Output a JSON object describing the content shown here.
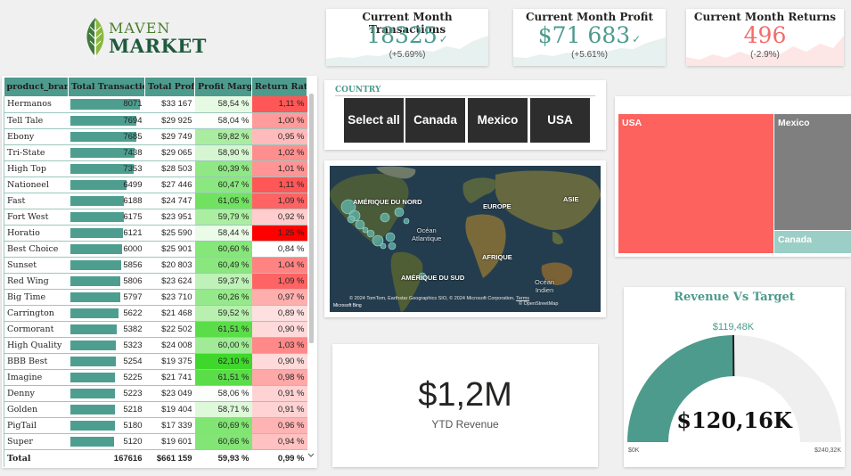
{
  "logo": {
    "line1": "MAVEN",
    "line2": "MARKET"
  },
  "kpis": [
    {
      "title": "Current Month Transactions",
      "value": "18325",
      "change": "(+5.69%)",
      "color": "#4d9b8d",
      "trend": "up"
    },
    {
      "title": "Current Month Profit",
      "value": "$71 683",
      "change": "(+5.61%)",
      "color": "#4d9b8d",
      "trend": "up"
    },
    {
      "title": "Current Month Returns",
      "value": "496",
      "change": "(-2.9%)",
      "color": "#f26b6b",
      "trend": "down"
    }
  ],
  "table": {
    "columns": [
      "product_brand",
      "Total Transactions",
      "Total Profit",
      "Profit Margin",
      "Return Rate"
    ],
    "rows": [
      {
        "brand": "Hermanos",
        "tx": "8071",
        "tx_value": 8071,
        "profit": "$33 167",
        "margin": "58,54 %",
        "margin_value": 58.54,
        "rr": "1,11 %",
        "rr_value": 1.11
      },
      {
        "brand": "Tell Tale",
        "tx": "7694",
        "tx_value": 7694,
        "profit": "$29 925",
        "margin": "58,04 %",
        "margin_value": 58.04,
        "rr": "1,00 %",
        "rr_value": 1.0
      },
      {
        "brand": "Ebony",
        "tx": "7685",
        "tx_value": 7685,
        "profit": "$29 749",
        "margin": "59,82 %",
        "margin_value": 59.82,
        "rr": "0,95 %",
        "rr_value": 0.95
      },
      {
        "brand": "Tri-State",
        "tx": "7438",
        "tx_value": 7438,
        "profit": "$29 065",
        "margin": "58,90 %",
        "margin_value": 58.9,
        "rr": "1,02 %",
        "rr_value": 1.02
      },
      {
        "brand": "High Top",
        "tx": "7353",
        "tx_value": 7353,
        "profit": "$28 503",
        "margin": "60,39 %",
        "margin_value": 60.39,
        "rr": "1,01 %",
        "rr_value": 1.01
      },
      {
        "brand": "Nationeel",
        "tx": "6499",
        "tx_value": 6499,
        "profit": "$27 446",
        "margin": "60,47 %",
        "margin_value": 60.47,
        "rr": "1,11 %",
        "rr_value": 1.11
      },
      {
        "brand": "Fast",
        "tx": "6188",
        "tx_value": 6188,
        "profit": "$24 747",
        "margin": "61,05 %",
        "margin_value": 61.05,
        "rr": "1,09 %",
        "rr_value": 1.09
      },
      {
        "brand": "Fort West",
        "tx": "6175",
        "tx_value": 6175,
        "profit": "$23 951",
        "margin": "59,79 %",
        "margin_value": 59.79,
        "rr": "0,92 %",
        "rr_value": 0.92
      },
      {
        "brand": "Horatio",
        "tx": "6121",
        "tx_value": 6121,
        "profit": "$25 590",
        "margin": "58,44 %",
        "margin_value": 58.44,
        "rr": "1,25 %",
        "rr_value": 1.25
      },
      {
        "brand": "Best Choice",
        "tx": "6000",
        "tx_value": 6000,
        "profit": "$25 901",
        "margin": "60,60 %",
        "margin_value": 60.6,
        "rr": "0,84 %",
        "rr_value": 0.84
      },
      {
        "brand": "Sunset",
        "tx": "5856",
        "tx_value": 5856,
        "profit": "$20 803",
        "margin": "60,49 %",
        "margin_value": 60.49,
        "rr": "1,04 %",
        "rr_value": 1.04
      },
      {
        "brand": "Red Wing",
        "tx": "5806",
        "tx_value": 5806,
        "profit": "$23 624",
        "margin": "59,37 %",
        "margin_value": 59.37,
        "rr": "1,09 %",
        "rr_value": 1.09
      },
      {
        "brand": "Big Time",
        "tx": "5797",
        "tx_value": 5797,
        "profit": "$23 710",
        "margin": "60,26 %",
        "margin_value": 60.26,
        "rr": "0,97 %",
        "rr_value": 0.97
      },
      {
        "brand": "Carrington",
        "tx": "5622",
        "tx_value": 5622,
        "profit": "$21 468",
        "margin": "59,52 %",
        "margin_value": 59.52,
        "rr": "0,89 %",
        "rr_value": 0.89
      },
      {
        "brand": "Cormorant",
        "tx": "5382",
        "tx_value": 5382,
        "profit": "$22 502",
        "margin": "61,51 %",
        "margin_value": 61.51,
        "rr": "0,90 %",
        "rr_value": 0.9
      },
      {
        "brand": "High Quality",
        "tx": "5323",
        "tx_value": 5323,
        "profit": "$24 008",
        "margin": "60,00 %",
        "margin_value": 60.0,
        "rr": "1,03 %",
        "rr_value": 1.03
      },
      {
        "brand": "BBB Best",
        "tx": "5254",
        "tx_value": 5254,
        "profit": "$19 375",
        "margin": "62,10 %",
        "margin_value": 62.1,
        "rr": "0,90 %",
        "rr_value": 0.9
      },
      {
        "brand": "Imagine",
        "tx": "5225",
        "tx_value": 5225,
        "profit": "$21 741",
        "margin": "61,51 %",
        "margin_value": 61.51,
        "rr": "0,98 %",
        "rr_value": 0.98
      },
      {
        "brand": "Denny",
        "tx": "5223",
        "tx_value": 5223,
        "profit": "$23 049",
        "margin": "58,06 %",
        "margin_value": 58.06,
        "rr": "0,91 %",
        "rr_value": 0.91
      },
      {
        "brand": "Golden",
        "tx": "5218",
        "tx_value": 5218,
        "profit": "$19 404",
        "margin": "58,71 %",
        "margin_value": 58.71,
        "rr": "0,91 %",
        "rr_value": 0.91
      },
      {
        "brand": "PigTail",
        "tx": "5180",
        "tx_value": 5180,
        "profit": "$17 339",
        "margin": "60,69 %",
        "margin_value": 60.69,
        "rr": "0,96 %",
        "rr_value": 0.96
      },
      {
        "brand": "Super",
        "tx": "5120",
        "tx_value": 5120,
        "profit": "$19 601",
        "margin": "60,66 %",
        "margin_value": 60.66,
        "rr": "0,94 %",
        "rr_value": 0.94
      }
    ],
    "total": {
      "label": "Total",
      "tx": "167616",
      "profit": "$661 159",
      "margin": "59,93 %",
      "rr": "0,99 %"
    }
  },
  "slicer": {
    "header": "COUNTRY",
    "options": [
      "Select all",
      "Canada",
      "Mexico",
      "USA"
    ]
  },
  "map": {
    "labels": {
      "na": "AMÉRIQUE DU NORD",
      "eu": "EUROPE",
      "as": "ASIE",
      "af": "AFRIQUE",
      "sa": "AMÉRIQUE DU SUD"
    },
    "oceans": {
      "atl1": "Océan",
      "atl2": "Atlantique",
      "ind1": "Océan",
      "ind2": "Indien"
    },
    "credit": "© 2024 TomTom, Earthstar Geographics SIO, © 2024 Microsoft Corporation,",
    "credit2": "© OpenStreetMap",
    "terms": "Terms",
    "bing": "Microsoft Bing"
  },
  "treemap": {
    "usa": "USA",
    "mexico": "Mexico",
    "canada": "Canada",
    "colors": {
      "usa": "#fd625e",
      "mexico": "#7f7f7f",
      "canada": "#9bcec6"
    }
  },
  "ytd": {
    "value": "$1,2M",
    "label": "YTD Revenue"
  },
  "gauge": {
    "title": "Revenue Vs Target",
    "value_label": "$120,16K",
    "target_label": "$119,48K",
    "min_label": "$0K",
    "max_label": "$240,32K",
    "value": 120.16,
    "target": 119.48,
    "min": 0,
    "max": 240.32,
    "fill_color": "#4d9b8d",
    "track_color": "#efefef"
  }
}
